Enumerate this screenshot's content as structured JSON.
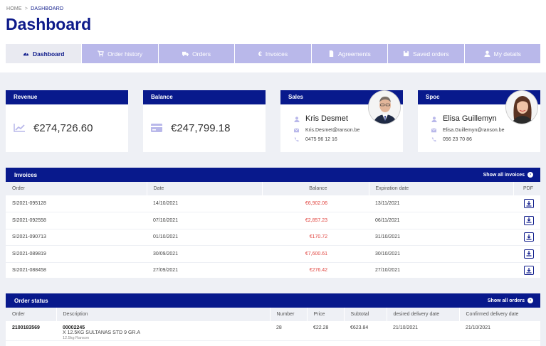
{
  "breadcrumb": {
    "home": "HOME",
    "separator": ">",
    "current": "DASHBOARD"
  },
  "page_title": "Dashboard",
  "tabs": [
    {
      "label": "Dashboard",
      "icon": "dashboard-icon",
      "active": true
    },
    {
      "label": "Order history",
      "icon": "cart-icon",
      "active": false
    },
    {
      "label": "Orders",
      "icon": "truck-icon",
      "active": false
    },
    {
      "label": "Invoices",
      "icon": "euro-icon",
      "active": false
    },
    {
      "label": "Agreements",
      "icon": "document-icon",
      "active": false
    },
    {
      "label": "Saved orders",
      "icon": "save-icon",
      "active": false
    },
    {
      "label": "My details",
      "icon": "user-icon",
      "active": false
    }
  ],
  "kpis": {
    "revenue": {
      "title": "Revenue",
      "value": "€274,726.60",
      "icon": "chart-line-icon"
    },
    "balance": {
      "title": "Balance",
      "value": "€247,799.18",
      "icon": "credit-card-icon"
    }
  },
  "contacts": {
    "sales": {
      "title": "Sales",
      "name": "Kris Desmet",
      "email": "Kris.Desmet@ranson.be",
      "phone": "0475 96 12 16"
    },
    "spoc": {
      "title": "Spoc",
      "name": "Elisa Guillemyn",
      "email": "Elisa.Guillemyn@ranson.be",
      "phone": "056 23 70 86"
    }
  },
  "invoices": {
    "title": "Invoices",
    "show_all": "Show all invoices",
    "columns": [
      "Order",
      "Date",
      "Balance",
      "Expiration date",
      "PDF"
    ],
    "rows": [
      {
        "order": "SI2021-095128",
        "date": "14/10/2021",
        "balance": "€6,902.06",
        "expiration": "13/11/2021"
      },
      {
        "order": "SI2021-092558",
        "date": "07/10/2021",
        "balance": "€2,857.23",
        "expiration": "06/11/2021"
      },
      {
        "order": "SI2021-090713",
        "date": "01/10/2021",
        "balance": "€170.72",
        "expiration": "31/10/2021"
      },
      {
        "order": "SI2021-089819",
        "date": "30/09/2021",
        "balance": "€7,600.61",
        "expiration": "30/10/2021"
      },
      {
        "order": "SI2021-088458",
        "date": "27/09/2021",
        "balance": "€276.42",
        "expiration": "27/10/2021"
      }
    ]
  },
  "order_status": {
    "title": "Order status",
    "show_all": "Show all orders",
    "columns": [
      "Order",
      "Description",
      "Number",
      "Price",
      "Subtotal",
      "desired delivery date",
      "Confirmed delivery date"
    ],
    "rows": [
      {
        "order": "2100183569",
        "code": "00002245",
        "description": "X 12.5KG SULTANAS STD 9 GR.A",
        "sub": "12.5kg Ranson",
        "number": "28",
        "price": "€22.28",
        "subtotal": "€623.84",
        "desired": "21/10/2021",
        "confirmed": "21/10/2021"
      }
    ]
  },
  "colors": {
    "primary": "#08198c",
    "tab_inactive": "#b9b8ea",
    "negative": "#e0443f",
    "background": "#eef0f5"
  }
}
